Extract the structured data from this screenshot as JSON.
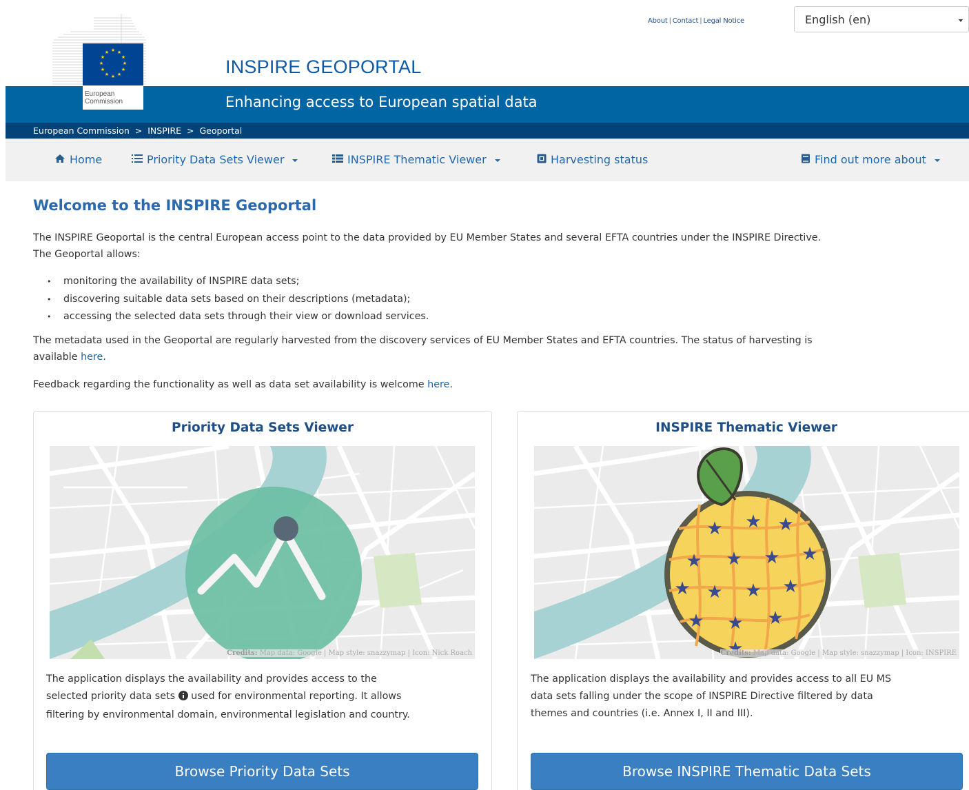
{
  "header": {
    "top_links": [
      "About",
      "Contact",
      "Legal Notice"
    ],
    "language": "English (en)",
    "logo_text": "European Commission",
    "site_title": "INSPIRE GEOPORTAL",
    "subtitle": "Enhancing access to European spatial data",
    "breadcrumb": [
      "European Commission",
      ">",
      "INSPIRE",
      ">",
      "Geoportal"
    ]
  },
  "nav": {
    "home": "Home",
    "priority": "Priority Data Sets Viewer",
    "thematic": "INSPIRE Thematic Viewer",
    "harvesting": "Harvesting status",
    "more": "Find out more about"
  },
  "main": {
    "heading": "Welcome to the INSPIRE Geoportal",
    "intro_1": "The INSPIRE Geoportal is the central European access point to the data provided by EU Member States and several EFTA countries under the INSPIRE Directive.",
    "intro_2": "The Geoportal allows:",
    "bullets": [
      "monitoring the availability of INSPIRE data sets;",
      "discovering suitable data sets based on their descriptions (metadata);",
      "accessing the selected data sets through their view or download services."
    ],
    "harvest_text": "The metadata used in the Geoportal are regularly harvested from the discovery services of EU Member States and EFTA countries. The status of harvesting is",
    "harvest_text_2": "available",
    "harvest_link": "here",
    "feedback_text": "Feedback regarding the functionality as well as data set availability is welcome",
    "feedback_link": "here"
  },
  "cards": {
    "priority": {
      "title": "Priority Data Sets Viewer",
      "credits_label": "Credits:",
      "credits": "Map data: Google | Map style: snazzymap | Icon: Nick Roach",
      "desc_1": "The application displays the availability and provides access to the",
      "desc_2a": "selected priority data sets",
      "desc_2b": "used for environmental reporting. It allows",
      "desc_3": "filtering by environmental domain, environmental legislation and country.",
      "button": "Browse Priority Data Sets"
    },
    "thematic": {
      "title": "INSPIRE Thematic Viewer",
      "credits_label": "Credits:",
      "credits": "Map data: Google | Map style: snazzymap | Icon: INSPIRE",
      "desc_1": "The application displays the availability and provides access to all EU MS",
      "desc_2": "data sets falling under the scope of INSPIRE Directive filtered by data",
      "desc_3": "themes and countries (i.e. Annex I, II and III).",
      "button": "Browse INSPIRE Thematic Data Sets"
    }
  },
  "colors": {
    "brand_blue": "#0065a2",
    "breadcrumb_blue": "#034379",
    "button_blue": "#3a7fc1",
    "heading_blue": "#2a6aad"
  }
}
